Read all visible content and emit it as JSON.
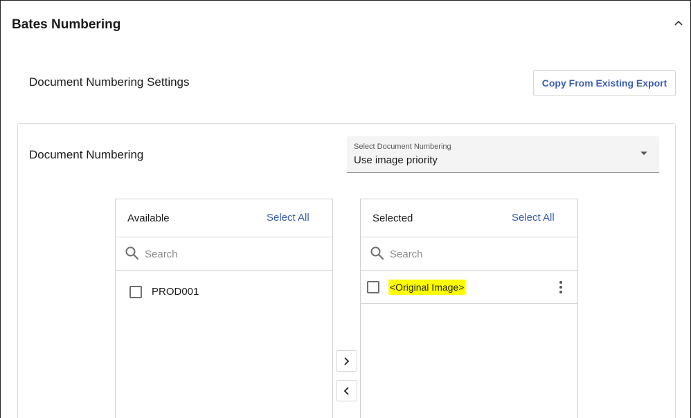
{
  "section": {
    "title": "Bates Numbering",
    "collapse_icon": "chevron-up-icon"
  },
  "settings": {
    "title": "Document Numbering Settings",
    "copy_button_label": "Copy From Existing Export"
  },
  "document_numbering": {
    "label": "Document Numbering",
    "select_caption": "Select Document Numbering",
    "select_value": "Use image priority"
  },
  "available": {
    "title": "Available",
    "select_all_label": "Select All",
    "search_placeholder": "Search",
    "items": [
      {
        "label": "PROD001",
        "checked": false
      }
    ]
  },
  "selected": {
    "title": "Selected",
    "select_all_label": "Select All",
    "search_placeholder": "Search",
    "items": [
      {
        "label": "<Original Image>",
        "checked": false,
        "highlight": "#ffff00"
      }
    ]
  },
  "transfer": {
    "move_right_icon": "chevron-right-icon",
    "move_left_icon": "chevron-left-icon"
  },
  "colors": {
    "accent": "#3b5ea8",
    "highlight": "#ffff00"
  }
}
